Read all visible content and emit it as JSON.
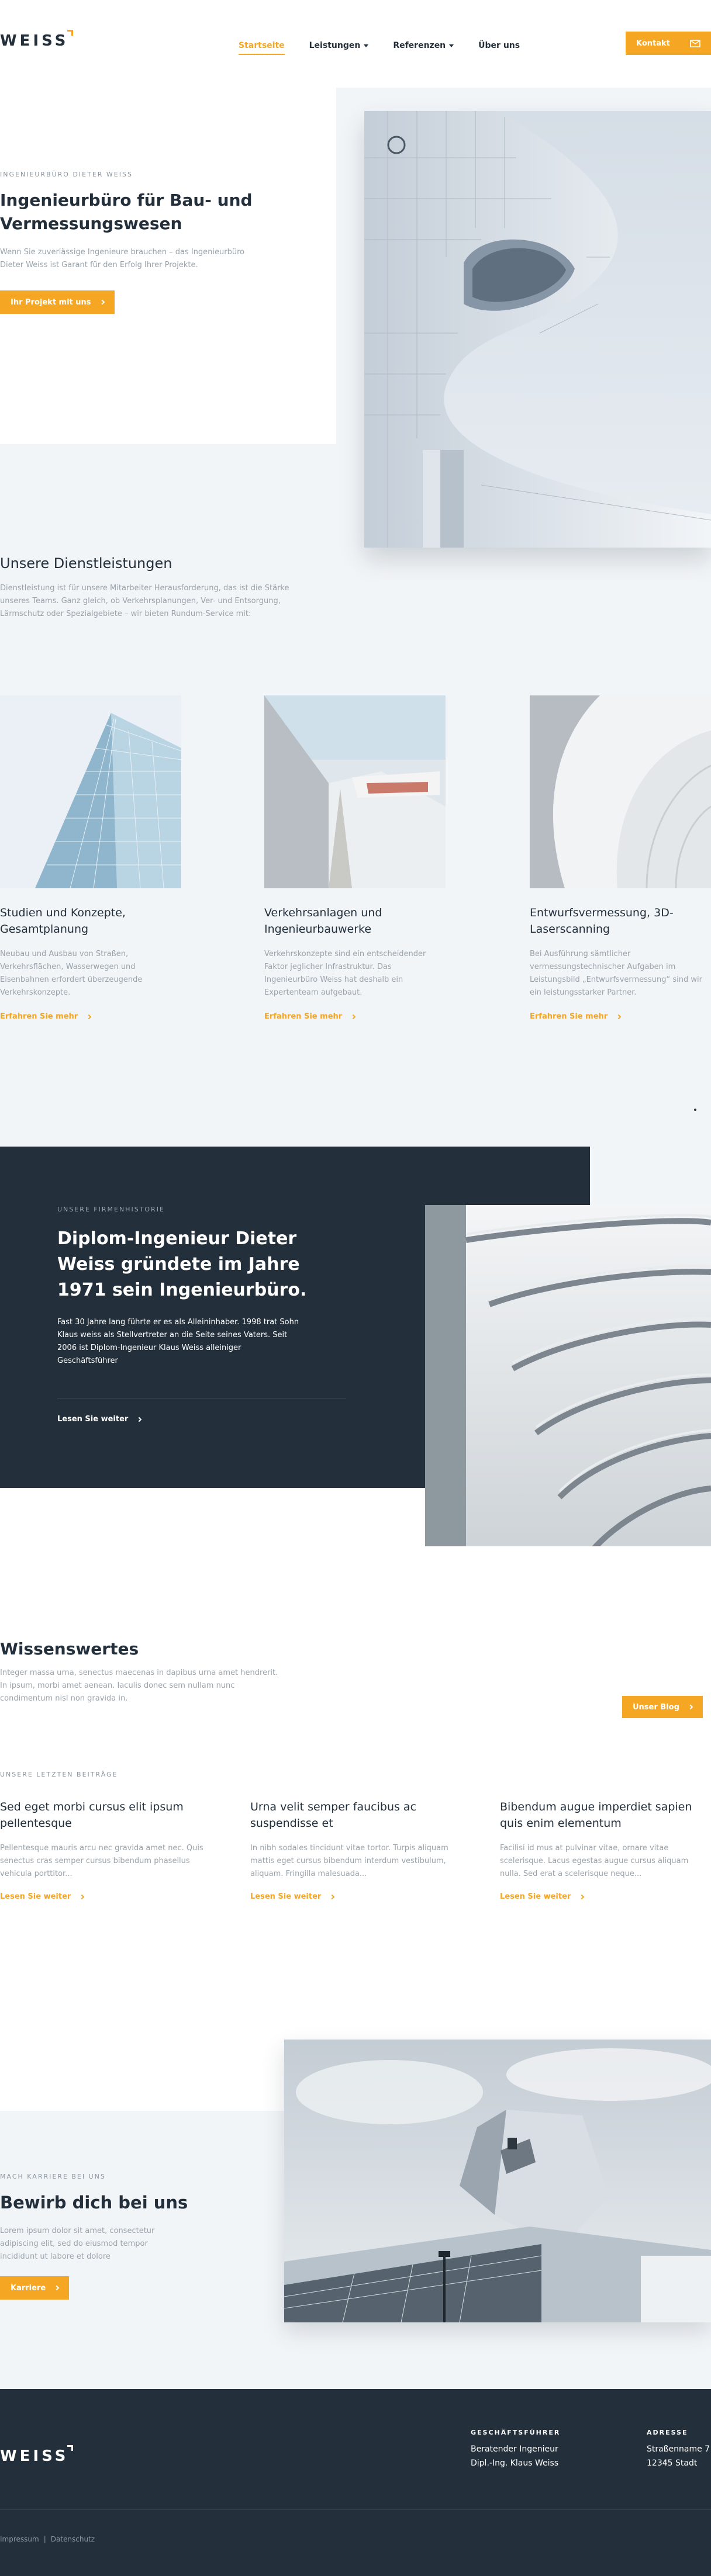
{
  "header": {
    "logo": "WEISS",
    "nav": [
      {
        "label": "Startseite",
        "active": true,
        "dropdown": false
      },
      {
        "label": "Leistungen",
        "active": false,
        "dropdown": true
      },
      {
        "label": "Referenzen",
        "active": false,
        "dropdown": true
      },
      {
        "label": "Über uns",
        "active": false,
        "dropdown": false
      }
    ],
    "contact_label": "Kontakt"
  },
  "hero": {
    "eyebrow": "INGENIEURBÜRO DIETER WEISS",
    "title": "Ingenieurbüro für Bau- und Vermessungswesen",
    "text": "Wenn Sie zuverlässige Ingenieure brauchen – das Ingenieurbüro Dieter Weiss ist Garant für den Erfolg Ihrer Projekte.",
    "cta": "Ihr Projekt mit uns"
  },
  "services": {
    "title": "Unsere Dienstleistungen",
    "text": "Dienstleistung ist für unsere Mitarbeiter Herausforderung, das ist die Stärke unseres Teams. Ganz gleich, ob Verkehrsplanungen, Ver- und Entsorgung, Lärmschutz oder Spezialgebiete – wir bieten Rundum-Service mit:",
    "items": [
      {
        "title": "Studien und Konzepte, Gesamtplanung",
        "text": "Neubau und Ausbau von Straßen, Verkehrsflächen, Wasserwegen und Eisenbahnen erfordert überzeugende Verkehrskonzepte.",
        "link": "Erfahren Sie mehr"
      },
      {
        "title": "Verkehrsanlagen und Ingenieurbauwerke",
        "text": "Verkehrskonzepte sind ein entscheidender Faktor jeglicher Infrastruktur. Das Ingenieurbüro Weiss hat deshalb ein Expertenteam aufgebaut.",
        "link": "Erfahren Sie mehr"
      },
      {
        "title": "Entwurfsvermessung, 3D-Laserscanning",
        "text": "Bei Ausführung sämtlicher vermessungstechnischer Aufgaben im Leistungsbild „Entwurfsvermessung“ sind wir ein leistungsstarker Partner.",
        "link": "Erfahren Sie mehr"
      }
    ]
  },
  "history": {
    "eyebrow": "UNSERE FIRMENHISTORIE",
    "title": "Diplom-Ingenieur Dieter Weiss gründete im Jahre 1971 sein Ingenieurbüro.",
    "text": "Fast 30 Jahre lang führte er es als Alleininhaber. 1998 trat Sohn Klaus weiss als Stellvertreter an die Seite seines Vaters. Seit 2006 ist Diplom-Ingenieur Klaus Weiss alleiniger Geschäftsführer",
    "link": "Lesen Sie weiter"
  },
  "knowledge": {
    "title": "Wissenswertes",
    "text": "Integer massa urna, senectus maecenas in dapibus urna amet hendrerit. In ipsum, morbi amet aenean. Iaculis donec sem nullam nunc condimentum nisl non gravida in.",
    "blog_button": "Unser Blog",
    "posts_eyebrow": "UNSERE LETZTEN BEITRÄGE",
    "posts": [
      {
        "title": "Sed eget morbi cursus elit ipsum pellentesque",
        "text": "Pellentesque mauris arcu nec gravida amet nec. Quis senectus cras semper cursus bibendum phasellus vehicula porttitor...",
        "link": "Lesen Sie weiter"
      },
      {
        "title": "Urna velit semper faucibus ac suspendisse et",
        "text": "In nibh sodales tincidunt vitae tortor. Turpis aliquam mattis eget cursus bibendum interdum vestibulum, aliquam. Fringilla malesuada...",
        "link": "Lesen Sie weiter"
      },
      {
        "title": "Bibendum augue imperdiet sapien quis enim elementum",
        "text": "Facilisi id mus at pulvinar vitae, ornare vitae scelerisque. Lacus egestas augue cursus aliquam nulla. Sed erat a scelerisque neque...",
        "link": "Lesen Sie weiter"
      }
    ]
  },
  "career": {
    "eyebrow": "MACH KARRIERE BEI UNS",
    "title": "Bewirb dich bei uns",
    "text": "Lorem ipsum dolor sit amet, consectetur adipiscing elit, sed do eiusmod tempor incididunt ut labore et dolore",
    "cta": "Karriere"
  },
  "footer": {
    "logo": "WEISS",
    "ceo_heading": "GESCHÄFTSFÜHRER",
    "ceo_lines": [
      "Beratender Ingenieur",
      "Dipl.-Ing. Klaus Weiss"
    ],
    "address_heading": "ADRESSE",
    "address_lines": [
      "Straßenname 7",
      "12345 Stadt"
    ],
    "links": [
      "Impressum",
      "Datenschutz"
    ],
    "separator": "|"
  },
  "colors": {
    "accent": "#f5a623",
    "dark": "#23303c",
    "background": "#f2f5f8"
  }
}
